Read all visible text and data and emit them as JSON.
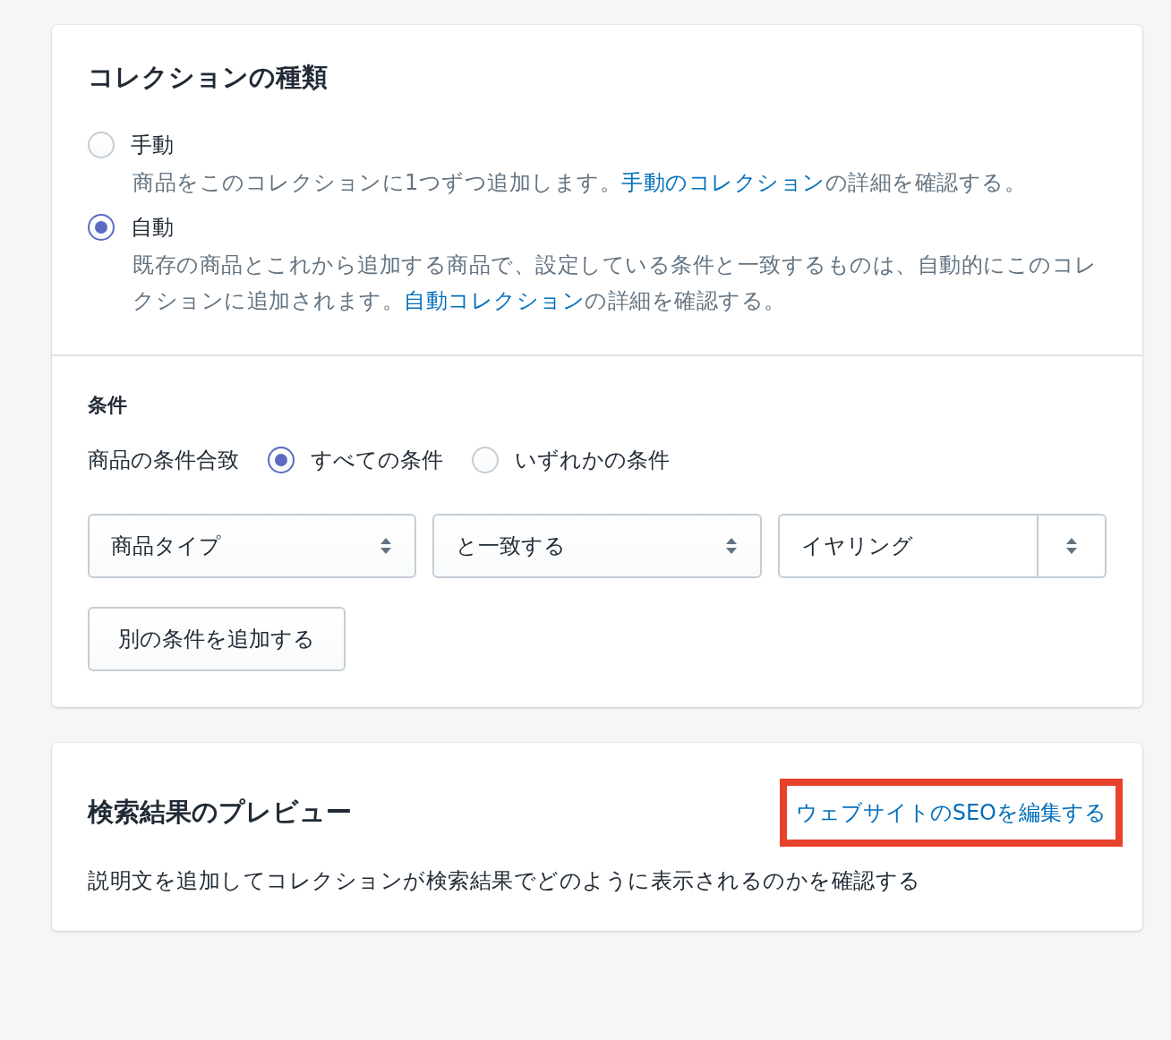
{
  "collection_type": {
    "title": "コレクションの種類",
    "options": [
      {
        "label": "手動",
        "selected": false,
        "before": "商品をこのコレクションに1つずつ追加します。",
        "link": "手動のコレクション",
        "after": "の詳細を確認する。"
      },
      {
        "label": "自動",
        "selected": true,
        "before": "既存の商品とこれから追加する商品で、設定している条件と一致するものは、自動的にこのコレクションに追加されます。",
        "link": "自動コレクション",
        "after": "の詳細を確認する。"
      }
    ]
  },
  "conditions": {
    "title": "条件",
    "match_label": "商品の条件合致",
    "match_options": [
      {
        "label": "すべての条件",
        "selected": true
      },
      {
        "label": "いずれかの条件",
        "selected": false
      }
    ],
    "rules": [
      {
        "field": "商品タイプ",
        "relation": "と一致する",
        "value": "イヤリング"
      }
    ],
    "add_button": "別の条件を追加する"
  },
  "seo": {
    "title": "検索結果のプレビュー",
    "link": {
      "text": "ウェブサイトのSEOを編集する",
      "highlighted": true
    },
    "description": "説明文を追加してコレクションが検索結果でどのように表示されるのかを確認する"
  }
}
